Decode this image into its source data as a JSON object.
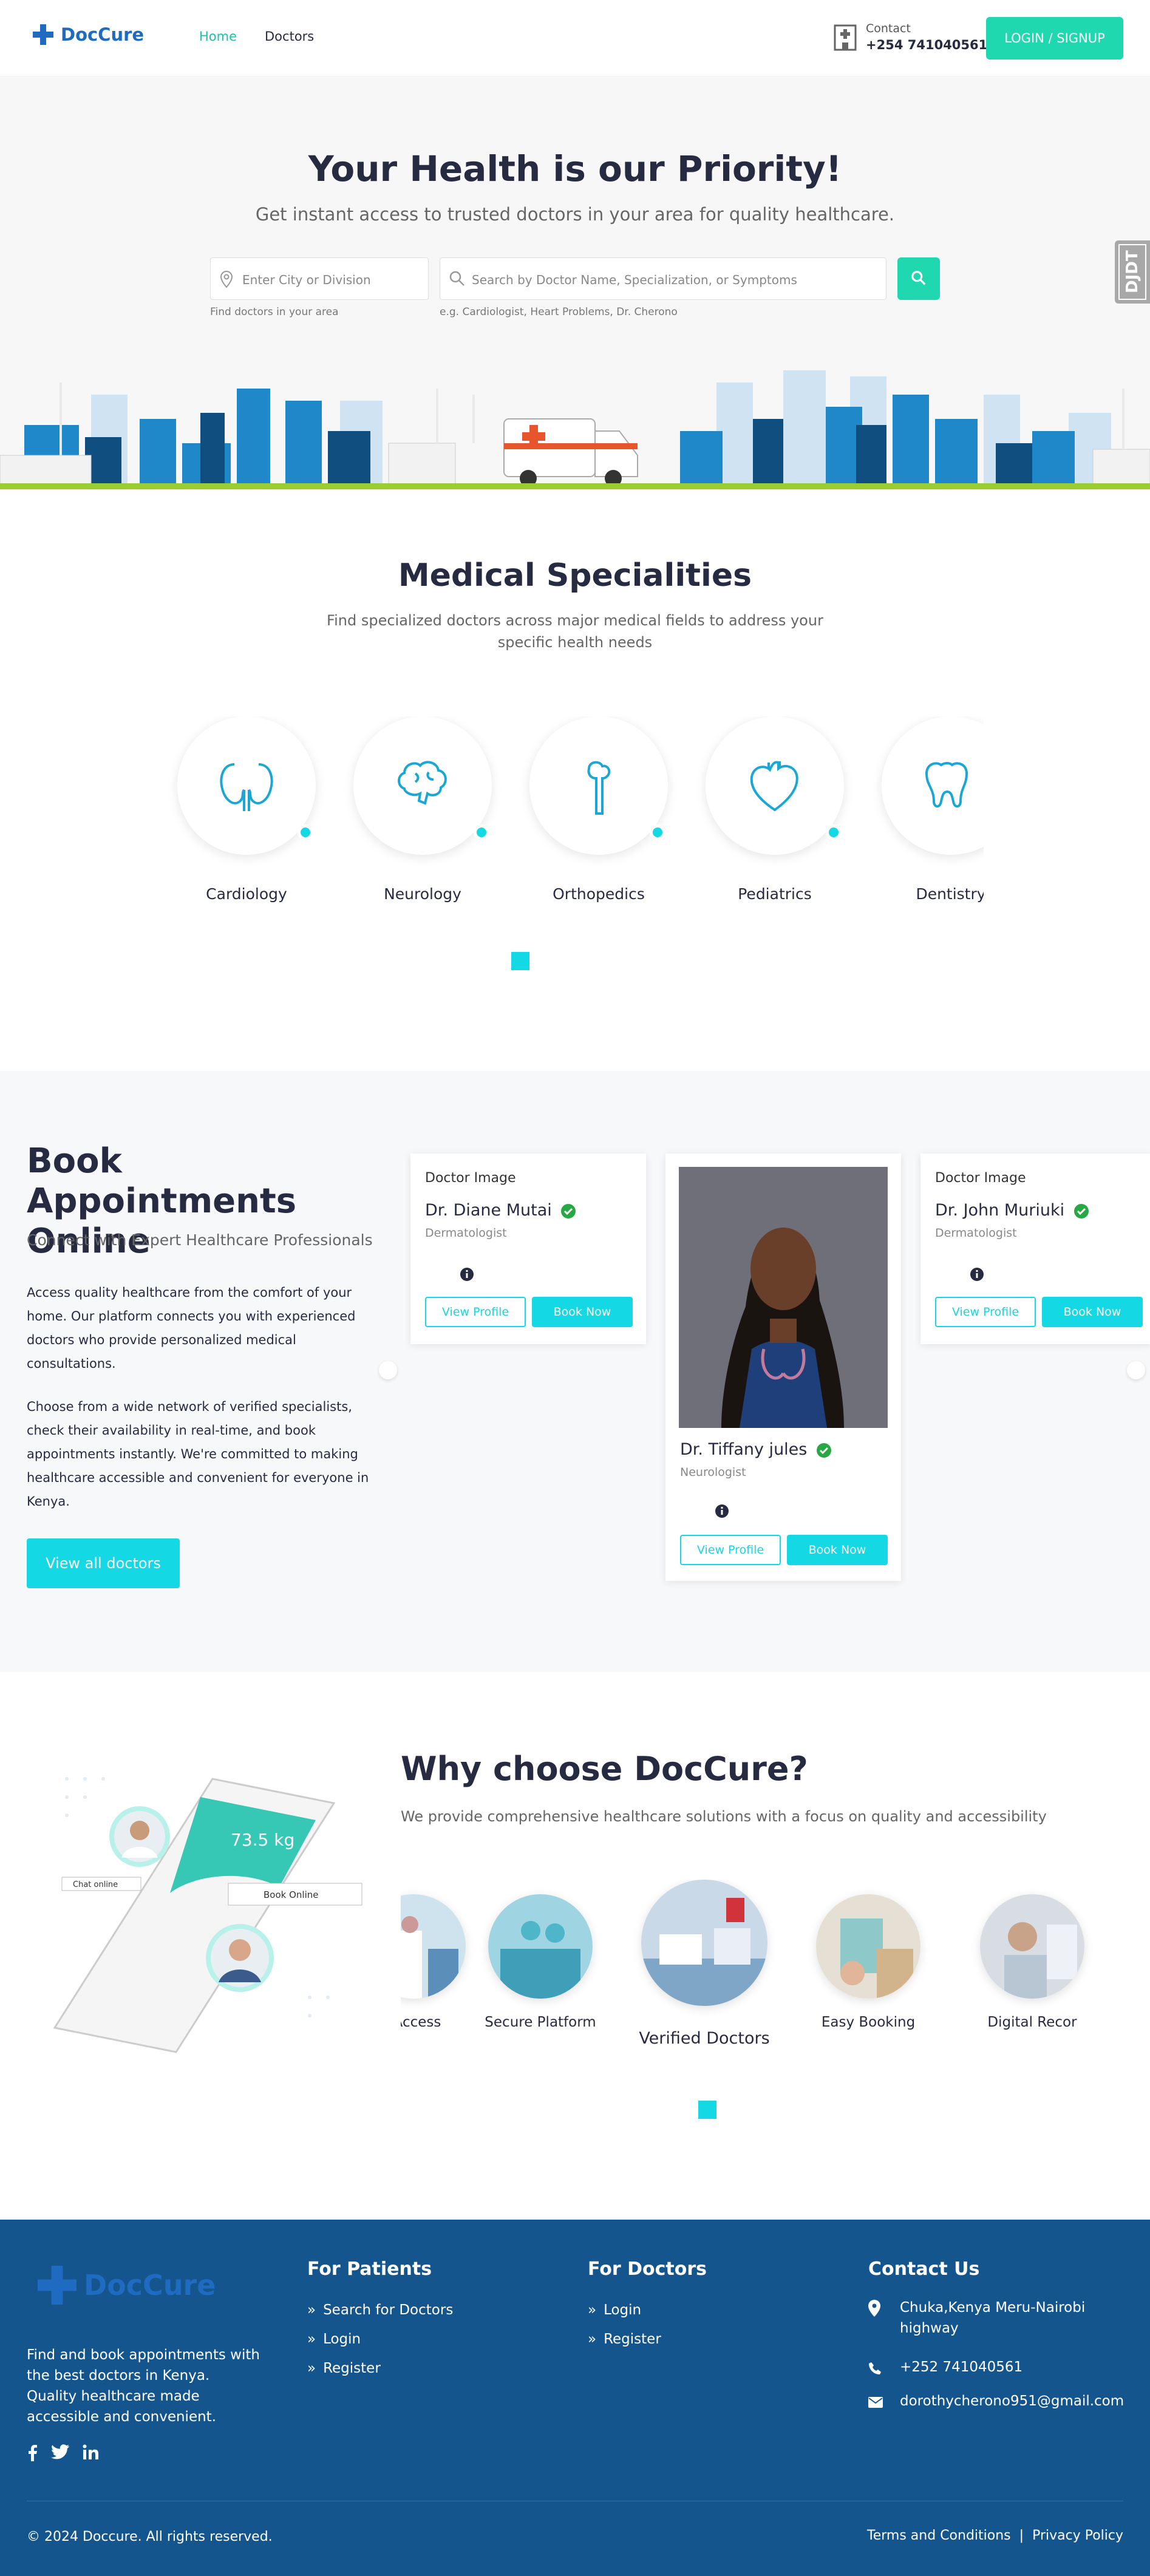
{
  "header": {
    "brand": "DocCure",
    "nav": [
      {
        "label": "Home",
        "active": true
      },
      {
        "label": "Doctors",
        "active": false
      }
    ],
    "contact_label": "Contact",
    "contact_phone": "+254 741040561",
    "login_label": "LOGIN / SIGNUP"
  },
  "hero": {
    "title": "Your Health is our Priority!",
    "subtitle": "Get instant access to trusted doctors in your area for quality healthcare.",
    "location_placeholder": "Enter City or Division",
    "location_hint": "Find doctors in your area",
    "search_placeholder": "Search by Doctor Name, Specialization, or Symptoms",
    "search_hint": "e.g. Cardiologist, Heart Problems, Dr. Cherono",
    "side_tab": "DJDT"
  },
  "specialities": {
    "title": "Medical Specialities",
    "subtitle": "Find specialized doctors across major medical fields to address your specific health needs",
    "items": [
      {
        "name": "Cardiology",
        "icon": "kidney-icon"
      },
      {
        "name": "Neurology",
        "icon": "brain-icon"
      },
      {
        "name": "Orthopedics",
        "icon": "bone-icon"
      },
      {
        "name": "Pediatrics",
        "icon": "heart-icon"
      },
      {
        "name": "Dentistry",
        "icon": "tooth-icon"
      }
    ]
  },
  "appointments": {
    "title": "Book Appointments Online",
    "subtitle": "Connect with Expert Healthcare Professionals",
    "paragraph1": "Access quality healthcare from the comfort of your home. Our platform connects you with experienced doctors who provide personalized medical consultations.",
    "paragraph2": "Choose from a wide network of verified specialists, check their availability in real-time, and book appointments instantly. We're committed to making healthcare accessible and convenient for everyone in Kenya.",
    "view_all_label": "View all doctors",
    "doctors": [
      {
        "image_alt": "Doctor Image",
        "name": "Dr. Diane Mutai",
        "specialty": "Dermatologist",
        "view_label": "View Profile",
        "book_label": "Book Now"
      },
      {
        "image_alt": "",
        "name": "Dr. Tiffany jules",
        "specialty": "Neurologist",
        "view_label": "View Profile",
        "book_label": "Book Now"
      },
      {
        "image_alt": "Doctor Image",
        "name": "Dr. John Muriuki",
        "specialty": "Dermatologist",
        "view_label": "View Profile",
        "book_label": "Book Now"
      }
    ]
  },
  "why": {
    "title": "Why choose DocCure?",
    "subtitle": "We provide comprehensive healthcare solutions with a focus on quality and accessibility",
    "items": [
      {
        "name": "tant Access"
      },
      {
        "name": "Secure Platform"
      },
      {
        "name": "Verified Doctors"
      },
      {
        "name": "Easy Booking"
      },
      {
        "name": "Digital Recor"
      }
    ],
    "phone_labels": {
      "chat": "Chat online",
      "book": "Book Online",
      "weight": "73.5 kg"
    }
  },
  "footer": {
    "brand": "DocCure",
    "about": "Find and book appointments with the best doctors in Kenya. Quality healthcare made accessible and convenient.",
    "patients_title": "For Patients",
    "patients_links": [
      "Search for Doctors",
      "Login",
      "Register"
    ],
    "doctors_title": "For Doctors",
    "doctors_links": [
      "Login",
      "Register"
    ],
    "contact_title": "Contact Us",
    "address": "Chuka,Kenya Meru-Nairobi highway",
    "phone": "+252 741040561",
    "email": "dorothycherono951@gmail.com",
    "copyright": "© 2024 Doccure. All rights reserved.",
    "terms": "Terms and Conditions",
    "separator": "|",
    "privacy": "Privacy Policy"
  },
  "colors": {
    "brand_blue": "#1f6bc2",
    "accent_teal": "#1fd8b0",
    "accent_cyan": "#14d8e4",
    "footer_bg": "#15558e"
  }
}
